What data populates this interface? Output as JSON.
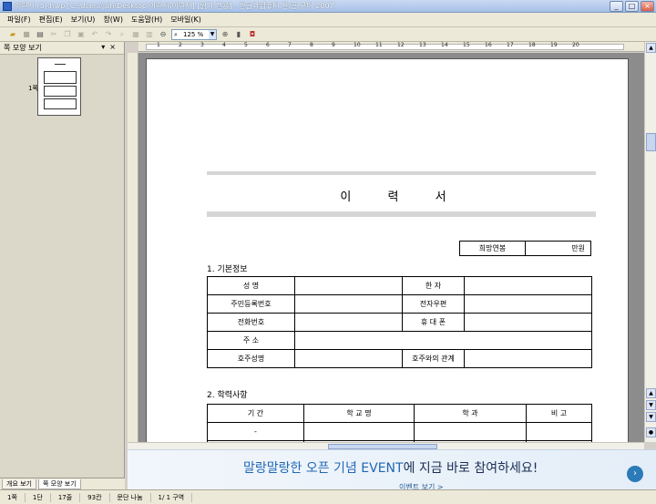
{
  "window": {
    "title": "이력서 (5).hwp [C:\\Users\\jdh\\Desktop\\이력서\\이력서] [읽기 전용] - 한글과컴퓨터 한/글 뷰어 2007",
    "controls": [
      "_",
      "□",
      "×"
    ]
  },
  "menu": {
    "items": [
      "파일(F)",
      "편집(E)",
      "보기(U)",
      "창(W)",
      "도움말(H)",
      "모바일(K)"
    ]
  },
  "toolbar": {
    "zoom_value": "125 %"
  },
  "side_panel": {
    "header": "쪽 모양 보기",
    "page_label": "1쪽",
    "tabs": [
      "개요 보기",
      "쪽 모양 보기"
    ]
  },
  "ruler": {
    "numbers": [
      "1",
      "2",
      "3",
      "4",
      "5",
      "6",
      "7",
      "8",
      "9",
      "10",
      "11",
      "12",
      "13",
      "14",
      "15",
      "16",
      "17",
      "18",
      "19",
      "20"
    ]
  },
  "document": {
    "title": "이 력 서",
    "salary_label": "희망연봉",
    "salary_unit": "만원",
    "section1_title": "1. 기본정보",
    "basic_rows": [
      [
        "성   명",
        "",
        "한   자",
        ""
      ],
      [
        "주민등록번호",
        "",
        "전자우편",
        ""
      ],
      [
        "전화번호",
        "",
        "휴 대 폰",
        ""
      ],
      [
        "주   소",
        "",
        "",
        ""
      ],
      [
        "호주성명",
        "",
        "호주와의 관계",
        ""
      ]
    ],
    "section2_title": "2. 학력사항",
    "edu_headers": [
      "기   간",
      "학   교   명",
      "학     과",
      "비   고"
    ],
    "edu_rows": [
      [
        "-",
        "",
        "",
        ""
      ],
      [
        "",
        "",
        "",
        ""
      ]
    ]
  },
  "banner": {
    "headline_a": "말랑말랑한 오픈 기념 EVENT",
    "headline_b": "에 지금 바로 참여하세요!",
    "sub": "이벤트 보기 >"
  },
  "status": {
    "items": [
      "1쪽",
      "1단",
      "17줄",
      "93칸",
      "문단 나눔",
      "1/   1 구역"
    ]
  },
  "colors": {
    "accent": "#2067b5",
    "title_bar": "#a7c0e8"
  }
}
